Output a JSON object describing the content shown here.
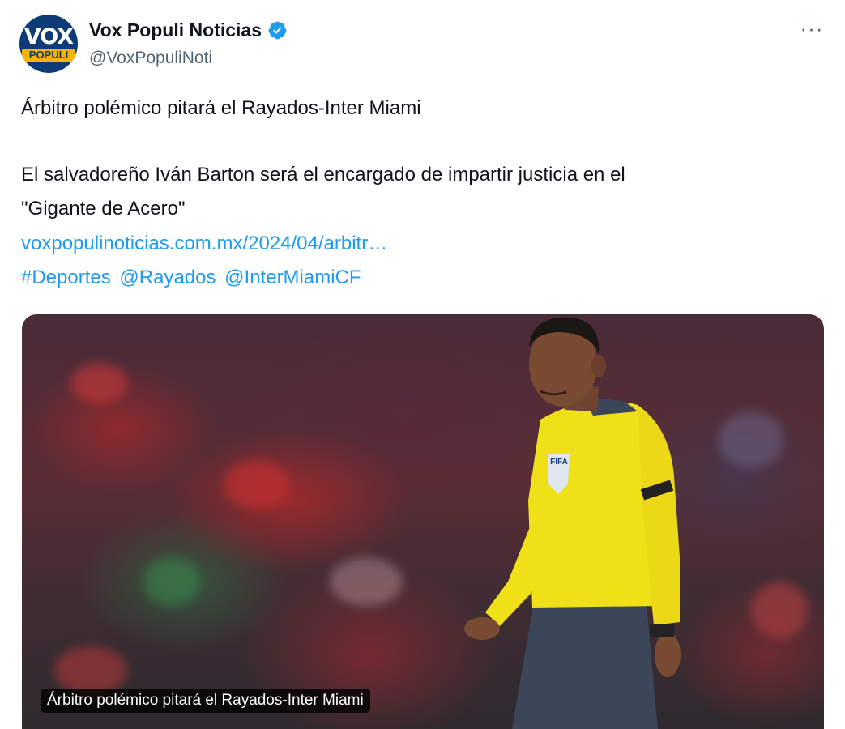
{
  "author": {
    "display_name": "Vox Populi Noticias",
    "handle": "@VoxPopuliNoti",
    "avatar_text_top": "VOX",
    "avatar_text_bottom": "POPULI"
  },
  "menu": {
    "more_label": "···"
  },
  "tweet": {
    "line1": "Árbitro polémico pitará el Rayados-Inter Miami",
    "line2": "El salvadoreño Iván Barton será el encargado de impartir justicia en el",
    "line3": "\"Gigante de Acero\"",
    "link": "voxpopulinoticias.com.mx/2024/04/arbitr…",
    "tags": [
      "#Deportes",
      "@Rayados",
      "@InterMiamiCF"
    ]
  },
  "media": {
    "caption": "Árbitro polémico pitará el Rayados-Inter Miami",
    "badge_text": "FIFA"
  },
  "colors": {
    "link": "#1d9bf0",
    "verified": "#1d9bf0",
    "text": "#0f1419",
    "muted": "#536471",
    "referee_shirt": "#f0e017"
  }
}
